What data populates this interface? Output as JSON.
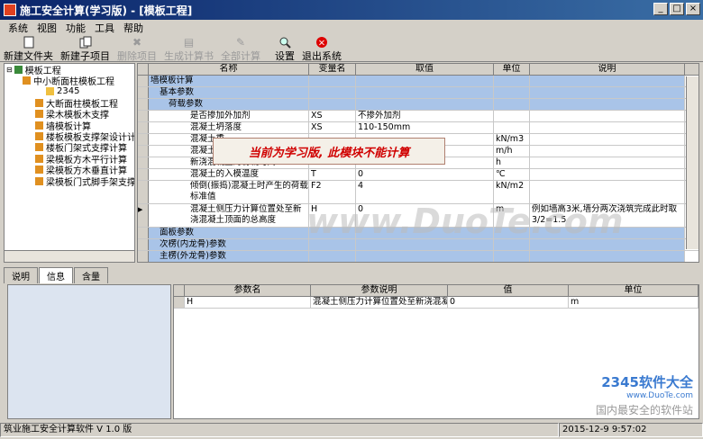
{
  "window": {
    "title": "施工安全计算(学习版) - [模板工程]"
  },
  "menu": [
    "系统",
    "视图",
    "功能",
    "工具",
    "帮助"
  ],
  "toolbar": {
    "new_folder": "新建文件夹",
    "new_subproject": "新建子项目",
    "delete_item": "删除项目",
    "generate_book": "生成计算书",
    "compute_all": "全部计算",
    "settings": "设置",
    "exit": "退出系统"
  },
  "tree": {
    "root": "模板工程",
    "items": [
      {
        "label": "中小断面柱模板工程",
        "level": 1
      },
      {
        "label": "2345",
        "level": 2
      },
      {
        "label": "大断面柱模板工程",
        "level": 1
      },
      {
        "label": "梁木模板木支撑",
        "level": 1
      },
      {
        "label": "墙模板计算",
        "level": 1
      },
      {
        "label": "楼板模板支撑架设计计",
        "level": 1
      },
      {
        "label": "楼板门架式支撑计算",
        "level": 1
      },
      {
        "label": "梁模板方木平行计算",
        "level": 1
      },
      {
        "label": "梁模板方木垂直计算",
        "level": 1
      },
      {
        "label": "梁模板门式脚手架支撑",
        "level": 1
      }
    ]
  },
  "grid": {
    "headers": [
      "名称",
      "变量名",
      "取值",
      "单位",
      "说明"
    ],
    "rows": [
      {
        "name": "墙模板计算",
        "var": "",
        "value": "",
        "unit": "",
        "desc": "",
        "type": "group0"
      },
      {
        "name": "基本参数",
        "var": "",
        "value": "",
        "unit": "",
        "desc": "",
        "type": "group1"
      },
      {
        "name": "荷载参数",
        "var": "",
        "value": "",
        "unit": "",
        "desc": "",
        "type": "group2"
      },
      {
        "name": "是否掺加外加剂",
        "var": "XS",
        "value": "不掺外加剂",
        "unit": "",
        "desc": "",
        "type": "item"
      },
      {
        "name": "混凝土坍落度",
        "var": "XS",
        "value": "110-150mm",
        "unit": "",
        "desc": "",
        "type": "item"
      },
      {
        "name": "混凝土重",
        "var": "",
        "value": "",
        "unit": "kN/m3",
        "desc": "",
        "type": "item"
      },
      {
        "name": "混凝土的",
        "var": "",
        "value": "",
        "unit": "m/h",
        "desc": "",
        "type": "item"
      },
      {
        "name": "新浇混凝土的初凝时间",
        "var": "t",
        "value": "0",
        "unit": "h",
        "desc": "",
        "type": "item"
      },
      {
        "name": "混凝土的入模温度",
        "var": "T",
        "value": "0",
        "unit": "℃",
        "desc": "",
        "type": "item"
      },
      {
        "name": "倾倒(振捣)混凝土时产生的荷载标准值",
        "var": "F2",
        "value": "4",
        "unit": "kN/m2",
        "desc": "",
        "type": "item2"
      },
      {
        "name": "混凝土侧压力计算位置处至新浇混凝土顶面的总高度",
        "var": "H",
        "value": "0",
        "unit": "m",
        "desc": "例如墙高3米,墙分两次浇筑完成此时取3/2=1.5",
        "type": "item2"
      },
      {
        "name": "面板参数",
        "var": "",
        "value": "",
        "unit": "",
        "desc": "",
        "type": "group1"
      },
      {
        "name": "次楞(内龙骨)参数",
        "var": "",
        "value": "",
        "unit": "",
        "desc": "",
        "type": "group1"
      },
      {
        "name": "主楞(外龙骨)参数",
        "var": "",
        "value": "",
        "unit": "",
        "desc": "",
        "type": "group1"
      },
      {
        "name": "螺栓参数",
        "var": "",
        "value": "",
        "unit": "",
        "desc": "",
        "type": "group1"
      }
    ]
  },
  "message": "当前为学习版, 此模块不能计算",
  "tabs": [
    "说明",
    "信息",
    "含量"
  ],
  "param_grid": {
    "headers": [
      "参数名",
      "参数说明",
      "值",
      "单位"
    ],
    "rows": [
      {
        "name": "H",
        "desc": "混凝土侧压力计算位置处至新浇混凝",
        "value": "0",
        "unit": "m"
      }
    ]
  },
  "status": {
    "left": "筑业施工安全计算软件 V 1.0 版",
    "datetime": "2015-12-9  9:57:02"
  },
  "watermark": "www.DuoTe.com",
  "brand": {
    "name": "2345软件大全",
    "site": "www.DuoTe.com",
    "tagline": "国内最安全的软件站"
  }
}
